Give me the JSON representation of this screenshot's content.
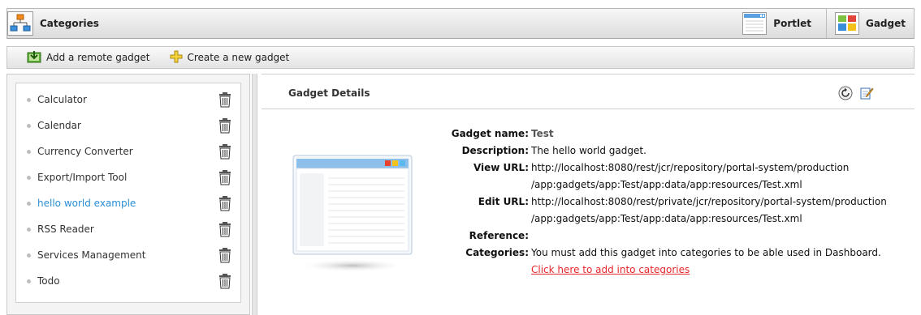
{
  "header": {
    "title": "Categories",
    "tabs": [
      {
        "label": "Portlet",
        "icon": "portlet-icon"
      },
      {
        "label": "Gadget",
        "icon": "gadget-icon"
      }
    ]
  },
  "toolbar": {
    "add_remote": "Add a remote gadget",
    "create_new": "Create a new gadget"
  },
  "sidebar": {
    "items": [
      {
        "label": "Calculator"
      },
      {
        "label": "Calendar"
      },
      {
        "label": "Currency Converter"
      },
      {
        "label": "Export/Import Tool"
      },
      {
        "label": "hello world example",
        "active": true
      },
      {
        "label": "RSS Reader"
      },
      {
        "label": "Services Management"
      },
      {
        "label": "Todo"
      }
    ]
  },
  "details": {
    "title": "Gadget Details",
    "name_label": "Gadget name:",
    "name_value": "Test",
    "desc_label": "Description:",
    "desc_value": "The hello world gadget.",
    "view_label": "View URL:",
    "view_line1": "http://localhost:8080/rest/jcr/repository/portal-system/production",
    "view_line2": "/app:gadgets/app:Test/app:data/app:resources/Test.xml",
    "edit_label": "Edit URL:",
    "edit_line1": "http://localhost:8080/rest/private/jcr/repository/portal-system/production",
    "edit_line2": "/app:gadgets/app:Test/app:data/app:resources/Test.xml",
    "ref_label": "Reference:",
    "ref_value": "",
    "cat_label": "Categories:",
    "cat_value": "You must add this gadget into categories to be able used in Dashboard.",
    "cat_link": "Click here to add into categories"
  },
  "colors": {
    "active_link": "#2a8fd6",
    "warning_link": "#e8262b"
  }
}
